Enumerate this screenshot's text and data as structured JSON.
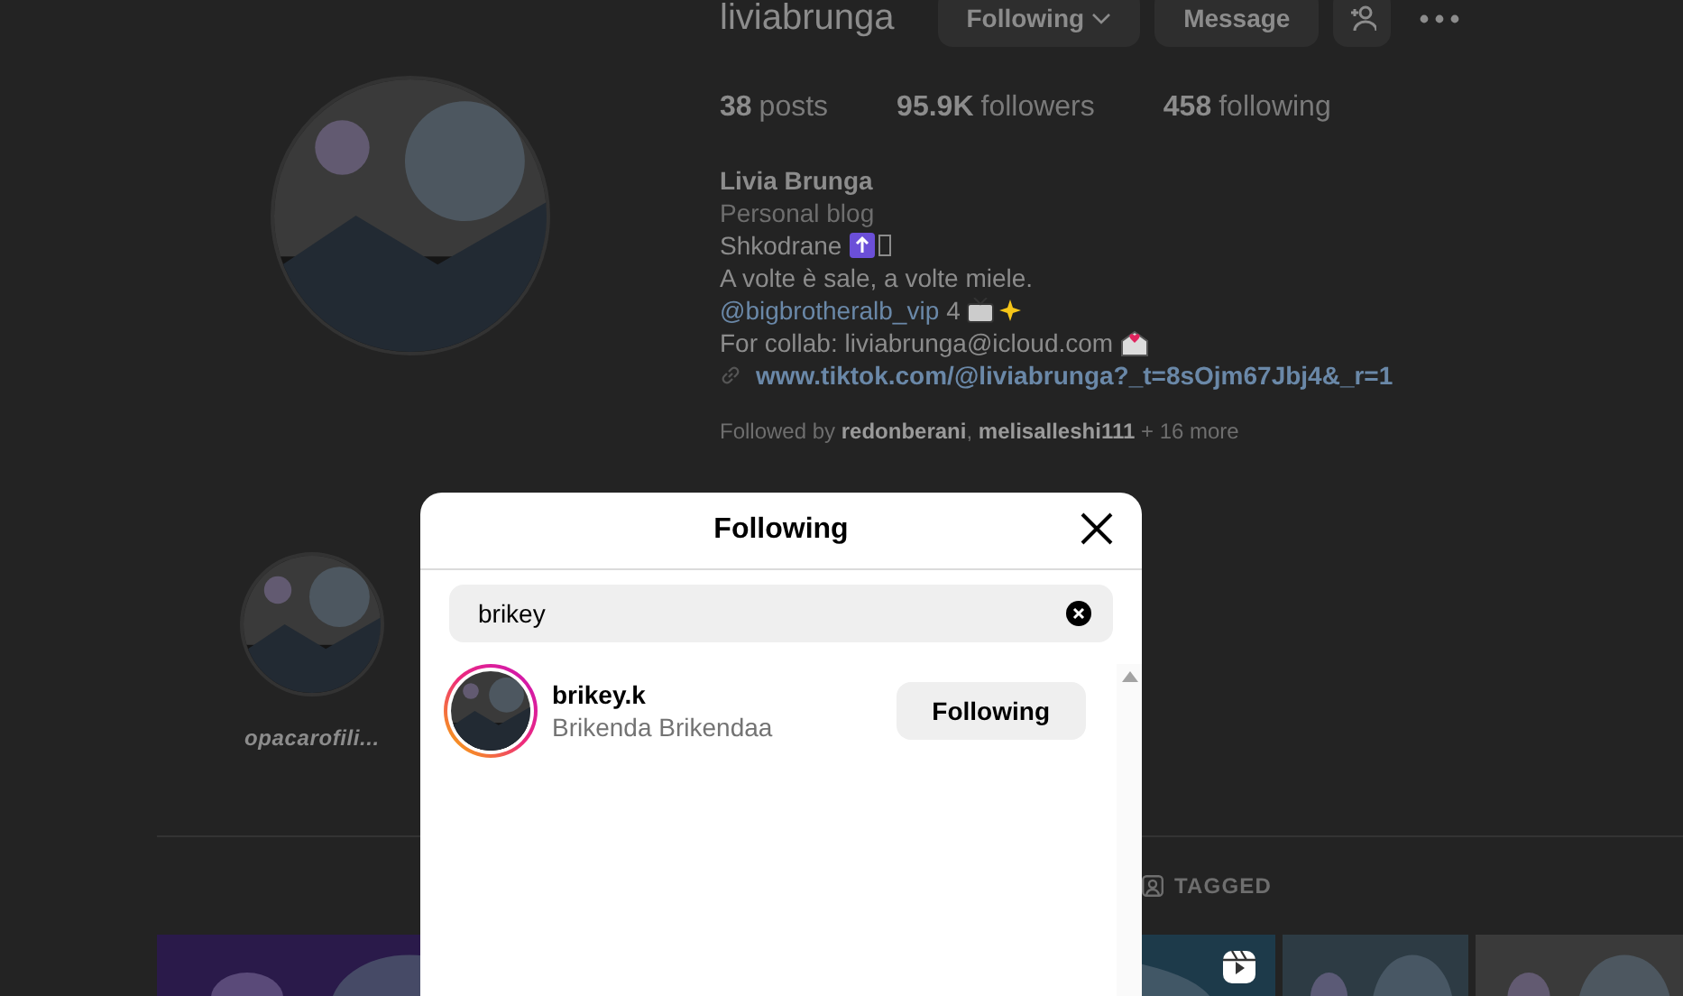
{
  "profile": {
    "username": "liviabrunga",
    "buttons": [
      {
        "kind": "menu",
        "label": "Following"
      },
      {
        "kind": "plain",
        "label": "Message"
      },
      {
        "kind": "add-person"
      },
      {
        "kind": "more"
      }
    ],
    "stats": [
      {
        "count": "38",
        "label": "posts"
      },
      {
        "count": "95.9K",
        "label": "followers"
      },
      {
        "count": "458",
        "label": "following"
      }
    ],
    "name": "Livia Brunga",
    "bio": [
      {
        "kind": "category",
        "text": "Personal blog"
      },
      {
        "kind": "text",
        "text": "Shkodrane"
      },
      {
        "kind": "text",
        "text": "A volte è sale, a volte miele."
      },
      {
        "kind": "mention",
        "mention": "@bigbrotheralb_vip",
        "text": "4"
      },
      {
        "kind": "text",
        "text": "For collab: liviabrunga@icloud.com"
      },
      {
        "kind": "link",
        "text": "www.tiktok.com/@liviabrunga?_t=8sOjm67Jbj4&_r=1"
      }
    ],
    "followed_by": "Followed by **redonberani**, **melisalleshi111** + 16 more"
  },
  "highlights": [
    {
      "label": "opacarofili..."
    }
  ],
  "tabs": [
    {
      "label": "TAGGED"
    }
  ],
  "modal": {
    "title": "Following",
    "search": {
      "value": "brikey"
    },
    "results": [
      {
        "username": "brikey.k",
        "full_name": "Brikenda Brikendaa",
        "button": "Following"
      }
    ]
  }
}
